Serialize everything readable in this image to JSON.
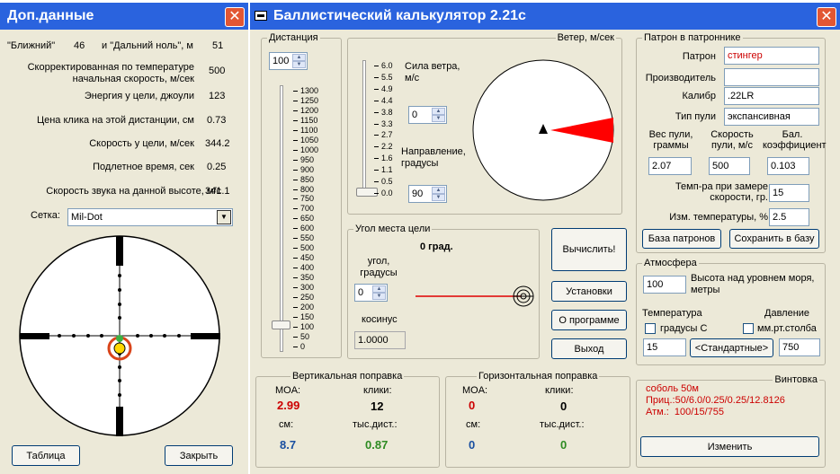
{
  "left_window": {
    "title": "Доп.данные",
    "stats": [
      {
        "label": "Скорректированная по температуре начальная скорость, м/сек",
        "value": "500"
      },
      {
        "label": "Энергия у цели, джоули",
        "value": "123"
      },
      {
        "label": "Цена клика на этой дистанции, см",
        "value": "0.73"
      },
      {
        "label": "Скорость у цели, м/сек",
        "value": "344.2"
      },
      {
        "label": "Подлетное время, сек",
        "value": "0.25"
      },
      {
        "label": "Скорость звука на данной высоте, м/с",
        "value": "341.1"
      }
    ],
    "zero_near_label": "\"Ближний\"",
    "zero_near_value": "46",
    "zero_far_label": "и \"Дальний ноль\", м",
    "zero_far_value": "51",
    "reticle_label": "Сетка:",
    "reticle_value": "Mil-Dot",
    "table_button": "Таблица",
    "close_button": "Закрыть"
  },
  "main_window": {
    "title": "Баллистический калькулятор 2.21с",
    "distance": {
      "legend": "Дистанция",
      "value": "100",
      "ticks": [
        "1300",
        "1250",
        "1200",
        "1150",
        "1100",
        "1050",
        "1000",
        "950",
        "900",
        "850",
        "800",
        "750",
        "700",
        "650",
        "600",
        "550",
        "500",
        "450",
        "400",
        "350",
        "300",
        "250",
        "200",
        "150",
        "100",
        "50",
        "0"
      ],
      "slider_value": 100
    },
    "wind": {
      "legend": "Ветер, м/сек",
      "ticks": [
        "6.0",
        "5.5",
        "4.9",
        "4.4",
        "3.8",
        "3.3",
        "2.7",
        "2.2",
        "1.6",
        "1.1",
        "0.5",
        "0.0"
      ],
      "speed_label": "Сила ветра, м/с",
      "speed_value": "0",
      "direction_label": "Направление, градусы",
      "direction_value": "90"
    },
    "angle": {
      "legend": "Угол места цели",
      "value_text": "0 град.",
      "angle_label": "угол, градусы",
      "angle_value": "0",
      "cosine_label": "косинус",
      "cosine_value": "1.0000"
    },
    "buttons": {
      "calculate": "Вычислить!",
      "settings": "Установки",
      "about": "О программе",
      "exit": "Выход"
    },
    "cartridge": {
      "legend": "Патрон в патроннике",
      "cartridge_label": "Патрон",
      "cartridge_value": "стингер",
      "manufacturer_label": "Производитель",
      "manufacturer_value": "",
      "caliber_label": "Калибр",
      "caliber_value": ".22LR",
      "bullet_type_label": "Тип пули",
      "bullet_type_value": "экспансивная",
      "weight_label": "Вес пули, граммы",
      "weight_value": "2.07",
      "speed_label": "Скорость пули, м/с",
      "speed_value": "500",
      "bc_label": "Бал. коэффициент",
      "bc_value": "0.103",
      "temp_measured_label": "Темп-ра при замере скорости, гр.",
      "temp_measured_value": "15",
      "temp_change_label": "Изм. температуры, %",
      "temp_change_value": "2.5",
      "db_button": "База патронов",
      "save_button": "Сохранить в базу"
    },
    "atmosphere": {
      "legend": "Атмосфера",
      "altitude_value": "100",
      "altitude_label": "Высота над уровнем моря, метры",
      "temperature_label": "Температура",
      "pressure_label": "Давление",
      "celsius_label": "градусы С",
      "mmhg_label": "мм.рт.столба",
      "temperature_value": "15",
      "standard_button": "<Стандартные>",
      "pressure_value": "750"
    },
    "vertical": {
      "legend": "Вертикальная поправка",
      "moa_label": "MOA:",
      "moa_value": "2.99",
      "clicks_label": "клики:",
      "clicks_value": "12",
      "cm_label": "см:",
      "cm_value": "8.7",
      "thousandths_label": "тыс.дист.:",
      "thousandths_value": "0.87"
    },
    "horizontal": {
      "legend": "Горизонтальная поправка",
      "moa_label": "MOA:",
      "moa_value": "0",
      "clicks_label": "клики:",
      "clicks_value": "0",
      "cm_label": "см:",
      "cm_value": "0",
      "thousandths_label": "тыс.дист.:",
      "thousandths_value": "0"
    },
    "rifle": {
      "legend": "Винтовка",
      "line1": "соболь 50м",
      "line2": "Приц.:50/6.0/0.25/0.25/12.8126",
      "line3": "Атм.:  100/15/755",
      "change_button": "Изменить"
    }
  },
  "colors": {
    "titlebar": "#2a63de",
    "window_bg": "#ece9d8",
    "wind_arrow": "#ff0000",
    "red_text": "#cc0000",
    "blue_text": "#1a4fa0",
    "green_text": "#2e8b22"
  }
}
